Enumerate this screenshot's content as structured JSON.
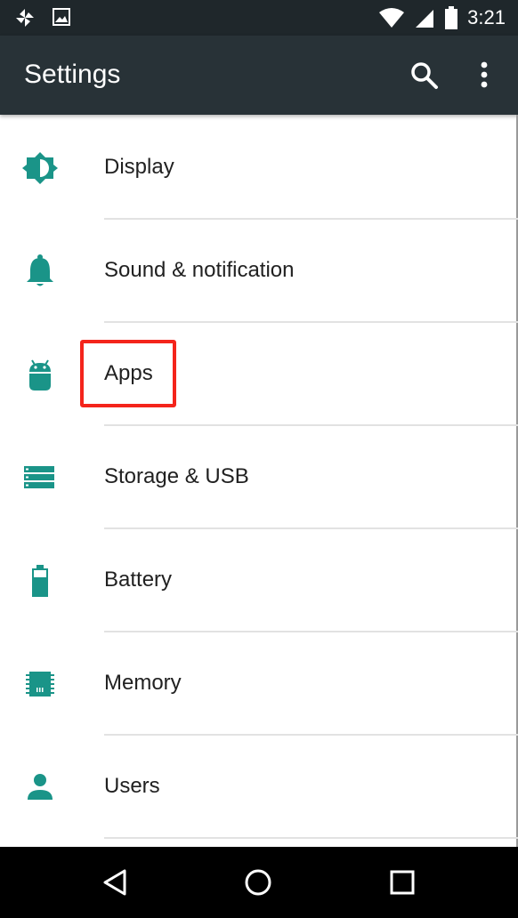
{
  "status_bar": {
    "time": "3:21",
    "left_icons": [
      "pinwheel-icon",
      "image-icon"
    ],
    "right_icons": [
      "wifi-icon",
      "signal-icon",
      "battery-icon"
    ]
  },
  "app_bar": {
    "title": "Settings",
    "actions": [
      "search-icon",
      "more-vert-icon"
    ]
  },
  "settings": {
    "items": [
      {
        "label": "Display",
        "icon": "brightness-icon"
      },
      {
        "label": "Sound & notification",
        "icon": "bell-icon"
      },
      {
        "label": "Apps",
        "icon": "android-icon"
      },
      {
        "label": "Storage & USB",
        "icon": "storage-icon"
      },
      {
        "label": "Battery",
        "icon": "battery-icon"
      },
      {
        "label": "Memory",
        "icon": "memory-chip-icon"
      },
      {
        "label": "Users",
        "icon": "person-icon"
      }
    ]
  },
  "highlight": {
    "target": "Apps",
    "color": "#f4241b"
  },
  "colors": {
    "accent": "#1a9488",
    "app_bar": "#283237",
    "status_bar": "#1f272b"
  },
  "nav_bar": {
    "buttons": [
      "back-icon",
      "home-icon",
      "recents-icon"
    ]
  }
}
